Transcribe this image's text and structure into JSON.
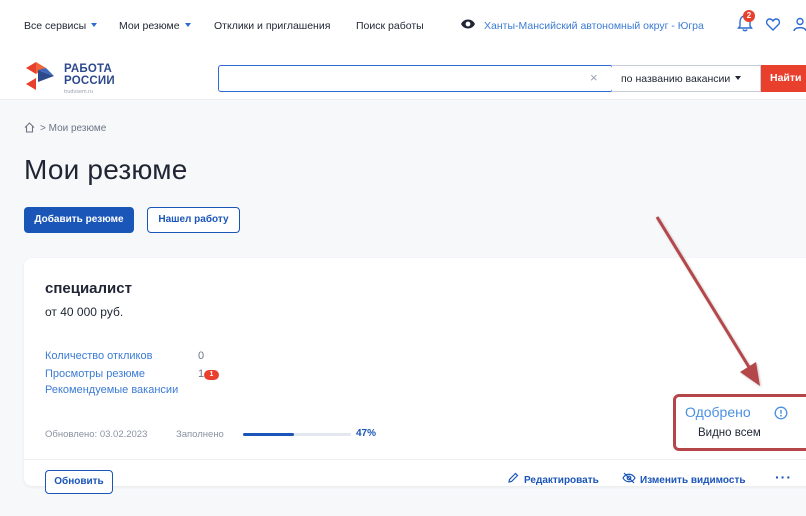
{
  "topnav": {
    "all_services": "Все сервисы",
    "my_resumes": "Мои резюме",
    "responses": "Отклики и приглашения",
    "job_search": "Поиск работы",
    "region": "Ханты-Мансийский автономный округ - Югра",
    "notifications_count": "2"
  },
  "logo": {
    "line1": "РАБОТА",
    "line2": "РОССИИ",
    "line3": "trudvsem.ru"
  },
  "search": {
    "value": "",
    "placeholder": "",
    "mode": "по названию вакансии",
    "button": "Найти"
  },
  "breadcrumb": {
    "current": "Мои резюме"
  },
  "page_title": "Мои резюме",
  "actions": {
    "add_resume": "Добавить резюме",
    "found_job": "Нашел работу"
  },
  "resume": {
    "title": "специалист",
    "salary": "от 40 000 руб.",
    "stats": [
      {
        "label": "Количество откликов",
        "value": "0"
      },
      {
        "label": "Просмотры резюме",
        "value": "1",
        "badge": "1"
      },
      {
        "label": "Рекомендуемые вакансии",
        "value": ""
      }
    ],
    "updated": "Обновлено: 03.02.2023",
    "filled_label": "Заполнено",
    "filled_percent": 47,
    "filled_text": "47%",
    "status": "Одобрено",
    "visibility": "Видно всем",
    "refresh": "Обновить",
    "edit": "Редактировать",
    "change_visibility": "Изменить видимость",
    "more": "···"
  },
  "colors": {
    "primary": "#1a55b8",
    "accent_red": "#e8402c",
    "status_blue": "#4a90e2",
    "annotation": "#b4464a"
  }
}
